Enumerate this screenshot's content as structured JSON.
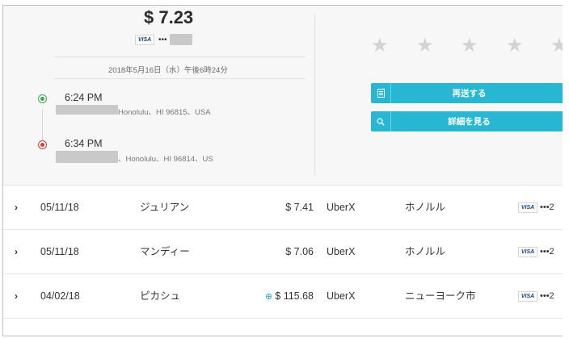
{
  "trip": {
    "fare": "$ 7.23",
    "card_brand": "VISA",
    "card_mask": "•••",
    "datetime": "2018年5月16日（水）午後6時24分",
    "pickup": {
      "time": "6:24 PM",
      "address": "Honolulu、HI 96815、USA"
    },
    "dropoff": {
      "time": "6:34 PM",
      "address": "、Honolulu、HI 96814、US"
    },
    "rating_stars": 5,
    "resend_label": "再送する",
    "details_label": "詳細を見る"
  },
  "colors": {
    "accent": "#27b7d3",
    "pickup": "#3aaa4a",
    "dropoff": "#dd3a30"
  },
  "trips": [
    {
      "date": "05/11/18",
      "rider": "ジュリアン",
      "amount": "$ 7.41",
      "product": "UberX",
      "city": "ホノルル",
      "card_brand": "VISA",
      "card_mask": "•••2",
      "promo": false
    },
    {
      "date": "05/11/18",
      "rider": "マンディー",
      "amount": "$ 7.06",
      "product": "UberX",
      "city": "ホノルル",
      "card_brand": "VISA",
      "card_mask": "•••2",
      "promo": false
    },
    {
      "date": "04/02/18",
      "rider": "ピカシュ",
      "amount": "$ 115.68",
      "product": "UberX",
      "city": "ニューヨーク市",
      "card_brand": "VISA",
      "card_mask": "•••2",
      "promo": true
    }
  ]
}
